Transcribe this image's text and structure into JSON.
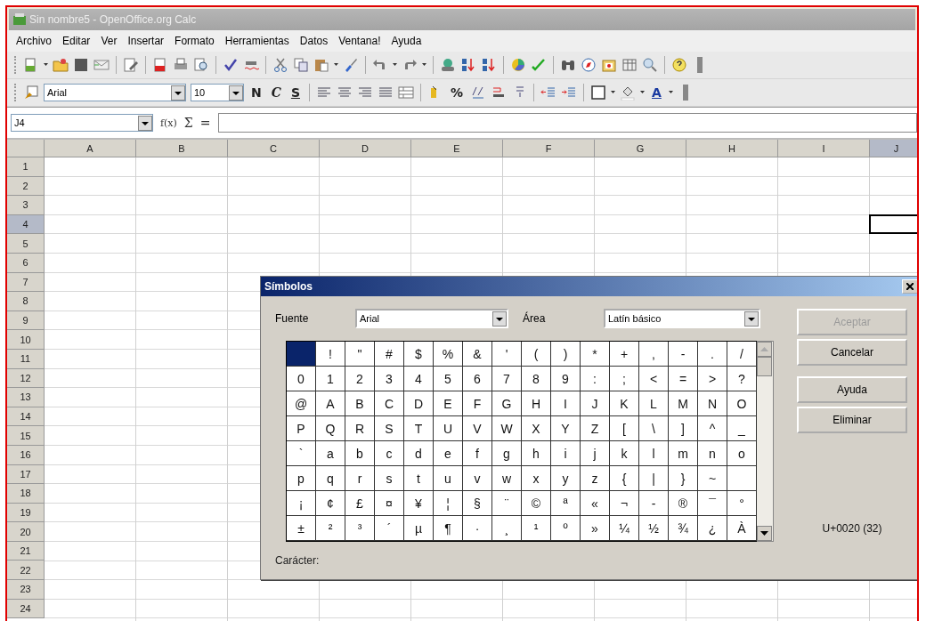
{
  "window": {
    "title": "Sin nombre5 - OpenOffice.org Calc"
  },
  "menu": [
    "Archivo",
    "Editar",
    "Ver",
    "Insertar",
    "Formato",
    "Herramientas",
    "Datos",
    "Ventana!",
    "Ayuda"
  ],
  "formatting": {
    "font_name": "Arial",
    "font_size": "10",
    "style_buttons": [
      "N",
      "C",
      "S"
    ],
    "percent_label": "%",
    "font_color_label": "A"
  },
  "formula_bar": {
    "name_box": "J4",
    "function_label": "f(x)",
    "sum_label": "Σ",
    "equals_label": "="
  },
  "sheet": {
    "columns": [
      {
        "label": "A",
        "selected": false
      },
      {
        "label": "B",
        "selected": false
      },
      {
        "label": "C",
        "selected": false
      },
      {
        "label": "D",
        "selected": false
      },
      {
        "label": "E",
        "selected": false
      },
      {
        "label": "F",
        "selected": false
      },
      {
        "label": "G",
        "selected": false
      },
      {
        "label": "H",
        "selected": false
      },
      {
        "label": "I",
        "selected": false
      },
      {
        "label": "J",
        "selected": true
      }
    ],
    "rows": [
      {
        "label": "1",
        "selected": false
      },
      {
        "label": "2",
        "selected": false
      },
      {
        "label": "3",
        "selected": false
      },
      {
        "label": "4",
        "selected": true
      },
      {
        "label": "5",
        "selected": false
      },
      {
        "label": "6",
        "selected": false
      },
      {
        "label": "7",
        "selected": false
      },
      {
        "label": "8",
        "selected": false
      },
      {
        "label": "9",
        "selected": false
      },
      {
        "label": "10",
        "selected": false
      },
      {
        "label": "11",
        "selected": false
      },
      {
        "label": "12",
        "selected": false
      },
      {
        "label": "13",
        "selected": false
      },
      {
        "label": "14",
        "selected": false
      },
      {
        "label": "15",
        "selected": false
      },
      {
        "label": "16",
        "selected": false
      },
      {
        "label": "17",
        "selected": false
      },
      {
        "label": "18",
        "selected": false
      },
      {
        "label": "19",
        "selected": false
      },
      {
        "label": "20",
        "selected": false
      },
      {
        "label": "21",
        "selected": false
      },
      {
        "label": "22",
        "selected": false
      },
      {
        "label": "23",
        "selected": false
      },
      {
        "label": "24",
        "selected": false
      }
    ]
  },
  "dialog": {
    "title": "Símbolos",
    "font_label": "Fuente",
    "font_value": "Arial",
    "area_label": "Área",
    "area_value": "Latín básico",
    "symbol_rows": [
      [
        {
          "selected": true
        },
        {
          "char": "!",
          "selected": false
        },
        {
          "char": "\"",
          "selected": false
        },
        {
          "char": "#",
          "selected": false
        },
        {
          "char": "$",
          "selected": false
        },
        {
          "char": "%",
          "selected": false
        },
        {
          "char": "&",
          "selected": false
        },
        {
          "char": "'",
          "selected": false
        },
        {
          "char": "(",
          "selected": false
        },
        {
          "char": ")",
          "selected": false
        },
        {
          "char": "*",
          "selected": false
        },
        {
          "char": "+",
          "selected": false
        },
        {
          "char": ",",
          "selected": false
        },
        {
          "char": "-",
          "selected": false
        },
        {
          "char": ".",
          "selected": false
        },
        {
          "char": "/",
          "selected": false
        }
      ],
      [
        {
          "char": "0",
          "selected": false
        },
        {
          "char": "1",
          "selected": false
        },
        {
          "char": "2",
          "selected": false
        },
        {
          "char": "3",
          "selected": false
        },
        {
          "char": "4",
          "selected": false
        },
        {
          "char": "5",
          "selected": false
        },
        {
          "char": "6",
          "selected": false
        },
        {
          "char": "7",
          "selected": false
        },
        {
          "char": "8",
          "selected": false
        },
        {
          "char": "9",
          "selected": false
        },
        {
          "char": ":",
          "selected": false
        },
        {
          "char": ";",
          "selected": false
        },
        {
          "char": "<",
          "selected": false
        },
        {
          "char": "=",
          "selected": false
        },
        {
          "char": ">",
          "selected": false
        },
        {
          "char": "?",
          "selected": false
        }
      ],
      [
        {
          "char": "@",
          "selected": false
        },
        {
          "char": "A",
          "selected": false
        },
        {
          "char": "B",
          "selected": false
        },
        {
          "char": "C",
          "selected": false
        },
        {
          "char": "D",
          "selected": false
        },
        {
          "char": "E",
          "selected": false
        },
        {
          "char": "F",
          "selected": false
        },
        {
          "char": "G",
          "selected": false
        },
        {
          "char": "H",
          "selected": false
        },
        {
          "char": "I",
          "selected": false
        },
        {
          "char": "J",
          "selected": false
        },
        {
          "char": "K",
          "selected": false
        },
        {
          "char": "L",
          "selected": false
        },
        {
          "char": "M",
          "selected": false
        },
        {
          "char": "N",
          "selected": false
        },
        {
          "char": "O",
          "selected": false
        }
      ],
      [
        {
          "char": "P",
          "selected": false
        },
        {
          "char": "Q",
          "selected": false
        },
        {
          "char": "R",
          "selected": false
        },
        {
          "char": "S",
          "selected": false
        },
        {
          "char": "T",
          "selected": false
        },
        {
          "char": "U",
          "selected": false
        },
        {
          "char": "V",
          "selected": false
        },
        {
          "char": "W",
          "selected": false
        },
        {
          "char": "X",
          "selected": false
        },
        {
          "char": "Y",
          "selected": false
        },
        {
          "char": "Z",
          "selected": false
        },
        {
          "char": "[",
          "selected": false
        },
        {
          "char": "\\",
          "selected": false
        },
        {
          "char": "]",
          "selected": false
        },
        {
          "char": "^",
          "selected": false
        },
        {
          "char": "_",
          "selected": false
        }
      ],
      [
        {
          "char": "`",
          "selected": false
        },
        {
          "char": "a",
          "selected": false
        },
        {
          "char": "b",
          "selected": false
        },
        {
          "char": "c",
          "selected": false
        },
        {
          "char": "d",
          "selected": false
        },
        {
          "char": "e",
          "selected": false
        },
        {
          "char": "f",
          "selected": false
        },
        {
          "char": "g",
          "selected": false
        },
        {
          "char": "h",
          "selected": false
        },
        {
          "char": "i",
          "selected": false
        },
        {
          "char": "j",
          "selected": false
        },
        {
          "char": "k",
          "selected": false
        },
        {
          "char": "l",
          "selected": false
        },
        {
          "char": "m",
          "selected": false
        },
        {
          "char": "n",
          "selected": false
        },
        {
          "char": "o",
          "selected": false
        }
      ],
      [
        {
          "char": "p",
          "selected": false
        },
        {
          "char": "q",
          "selected": false
        },
        {
          "char": "r",
          "selected": false
        },
        {
          "char": "s",
          "selected": false
        },
        {
          "char": "t",
          "selected": false
        },
        {
          "char": "u",
          "selected": false
        },
        {
          "char": "v",
          "selected": false
        },
        {
          "char": "w",
          "selected": false
        },
        {
          "char": "x",
          "selected": false
        },
        {
          "char": "y",
          "selected": false
        },
        {
          "char": "z",
          "selected": false
        },
        {
          "char": "{",
          "selected": false
        },
        {
          "char": "|",
          "selected": false
        },
        {
          "char": "}",
          "selected": false
        },
        {
          "char": "~",
          "selected": false
        },
        {
          "selected": false
        }
      ],
      [
        {
          "char": "¡",
          "selected": false
        },
        {
          "char": "¢",
          "selected": false
        },
        {
          "char": "£",
          "selected": false
        },
        {
          "char": "¤",
          "selected": false
        },
        {
          "char": "¥",
          "selected": false
        },
        {
          "char": "¦",
          "selected": false
        },
        {
          "char": "§",
          "selected": false
        },
        {
          "char": "¨",
          "selected": false
        },
        {
          "char": "©",
          "selected": false
        },
        {
          "char": "ª",
          "selected": false
        },
        {
          "char": "«",
          "selected": false
        },
        {
          "char": "¬",
          "selected": false
        },
        {
          "char": "-",
          "selected": false
        },
        {
          "char": "®",
          "selected": false
        },
        {
          "char": "¯",
          "selected": false
        },
        {
          "char": "°",
          "selected": false
        }
      ],
      [
        {
          "char": "±",
          "selected": false
        },
        {
          "char": "²",
          "selected": false
        },
        {
          "char": "³",
          "selected": false
        },
        {
          "char": "´",
          "selected": false
        },
        {
          "char": "µ",
          "selected": false
        },
        {
          "char": "¶",
          "selected": false
        },
        {
          "char": "·",
          "selected": false
        },
        {
          "char": "¸",
          "selected": false
        },
        {
          "char": "¹",
          "selected": false
        },
        {
          "char": "º",
          "selected": false
        },
        {
          "char": "»",
          "selected": false
        },
        {
          "char": "¼",
          "selected": false
        },
        {
          "char": "½",
          "selected": false
        },
        {
          "char": "¾",
          "selected": false
        },
        {
          "char": "¿",
          "selected": false
        },
        {
          "char": "À",
          "selected": false
        }
      ]
    ],
    "buttons": [
      {
        "label": "Aceptar",
        "disabled": true
      },
      {
        "label": "Cancelar",
        "disabled": false
      },
      {
        "label": "Ayuda",
        "disabled": false
      },
      {
        "label": "Eliminar",
        "disabled": false
      }
    ],
    "code_point": "U+0020 (32)",
    "character_label": "Carácter:"
  }
}
